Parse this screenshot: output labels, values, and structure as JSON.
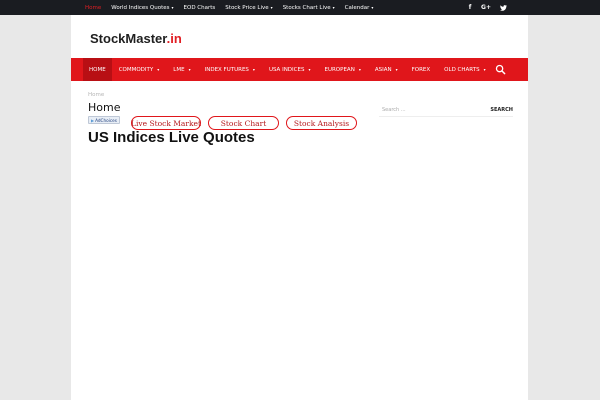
{
  "topbar": {
    "links": [
      {
        "label": "Home",
        "active": true
      },
      {
        "label": "World Indices Quotes",
        "dropdown": true
      },
      {
        "label": "EOD Charts"
      },
      {
        "label": "Stock Price Live",
        "dropdown": true
      },
      {
        "label": "Stocks Chart Live",
        "dropdown": true
      },
      {
        "label": "Calendar",
        "dropdown": true
      }
    ],
    "social": {
      "facebook": "f",
      "google_plus": "G+",
      "twitter": "twitter-icon"
    }
  },
  "header": {
    "logo_main": "StockMaster",
    "logo_suffix": ".in"
  },
  "nav": {
    "items": [
      {
        "label": "HOME"
      },
      {
        "label": "COMMODITY",
        "dropdown": true
      },
      {
        "label": "LME",
        "dropdown": true
      },
      {
        "label": "INDEX FUTURES",
        "dropdown": true
      },
      {
        "label": "USA INDICES",
        "dropdown": true
      },
      {
        "label": "EUROPEAN",
        "dropdown": true
      },
      {
        "label": "ASIAN",
        "dropdown": true
      },
      {
        "label": "FOREX"
      },
      {
        "label": "OLD CHARTS",
        "dropdown": true
      }
    ],
    "caret": "▾"
  },
  "content": {
    "breadcrumb": "Home",
    "heading": "Home",
    "adchoices": "AdChoices",
    "pills": [
      "Live Stock Market",
      "Stock Chart",
      "Stock Analysis"
    ],
    "title": "US Indices Live Quotes"
  },
  "sidebar": {
    "search_placeholder": "Search ...",
    "search_button": "SEARCH"
  },
  "colors": {
    "accent": "#e0161b",
    "topbar": "#1a1c21",
    "background": "#e8e8e8"
  }
}
